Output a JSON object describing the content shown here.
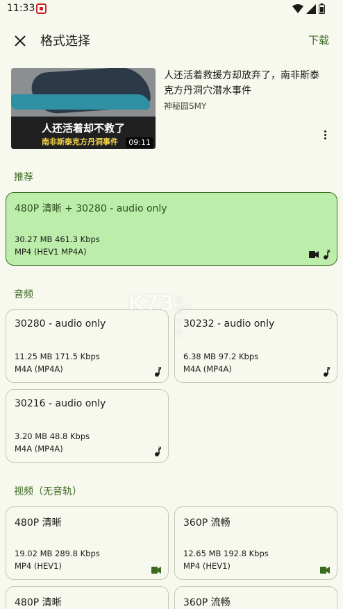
{
  "status_bar": {
    "time": "11:33"
  },
  "toolbar": {
    "title": "格式选择",
    "download_label": "下载"
  },
  "video": {
    "title": "人还活着救援方却放弃了，南非斯泰克方丹洞穴潜水事件",
    "author": "神秘园SMY",
    "duration": "09:11",
    "thumb_line1": "人还活着却不救了",
    "thumb_line2": "南非斯泰克方丹洞事件"
  },
  "sections": {
    "recommended": "推荐",
    "audio": "音频",
    "video_no_audio": "视频（无音轨）"
  },
  "recommended_card": {
    "title": "480P 清晰 + 30280 - audio only",
    "size": "30.27 MB 461.3 Kbps",
    "format": "MP4 (HEV1 MP4A)"
  },
  "audio_cards": [
    {
      "title": "30280 - audio only",
      "size": "11.25 MB 171.5 Kbps",
      "format": "M4A (MP4A)"
    },
    {
      "title": "30232 - audio only",
      "size": "6.38 MB 97.2 Kbps",
      "format": "M4A (MP4A)"
    },
    {
      "title": "30216 - audio only",
      "size": "3.20 MB 48.8 Kbps",
      "format": "M4A (MP4A)"
    }
  ],
  "video_cards": [
    {
      "title": "480P 清晰",
      "size": "19.02 MB 289.8 Kbps",
      "format": "MP4 (HEV1)"
    },
    {
      "title": "360P 流畅",
      "size": "12.65 MB 192.8 Kbps",
      "format": "MP4 (HEV1)"
    },
    {
      "title": "480P 清晰"
    },
    {
      "title": "360P 流畅"
    }
  ],
  "watermark": {
    "logo": "K73",
    "line1": "游戏之家",
    "line2": ".com"
  },
  "colors": {
    "accent": "#3b6a20",
    "selected_bg": "#bcedab",
    "background": "#f7f8ee"
  }
}
